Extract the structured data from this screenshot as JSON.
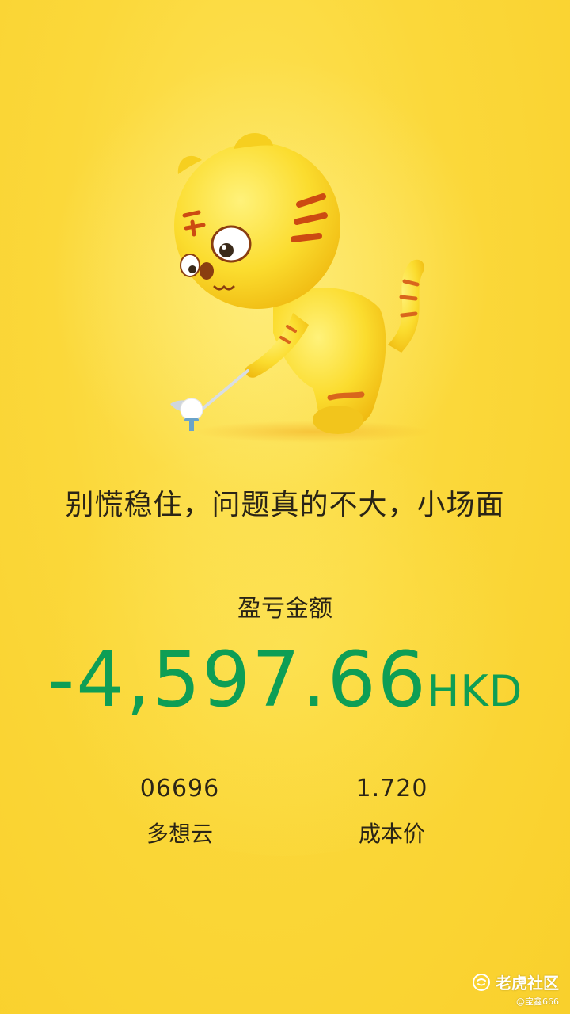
{
  "mascot": {
    "icon": "tiger-golf-mascot"
  },
  "slogan": "别慌稳住，问题真的不大，小场面",
  "profit_loss": {
    "label": "盈亏金额",
    "value": "-4,597.66",
    "currency": "HKD",
    "color": "#0e9e55"
  },
  "stock": {
    "code": "06696",
    "name": "多想云"
  },
  "cost": {
    "value": "1.720",
    "label": "成本价"
  },
  "watermark": {
    "brand": "老虎社区",
    "user": "@宝鑫666"
  },
  "colors": {
    "background": "#fbd83a",
    "text": "#2a2416",
    "loss_green": "#0e9e55"
  }
}
